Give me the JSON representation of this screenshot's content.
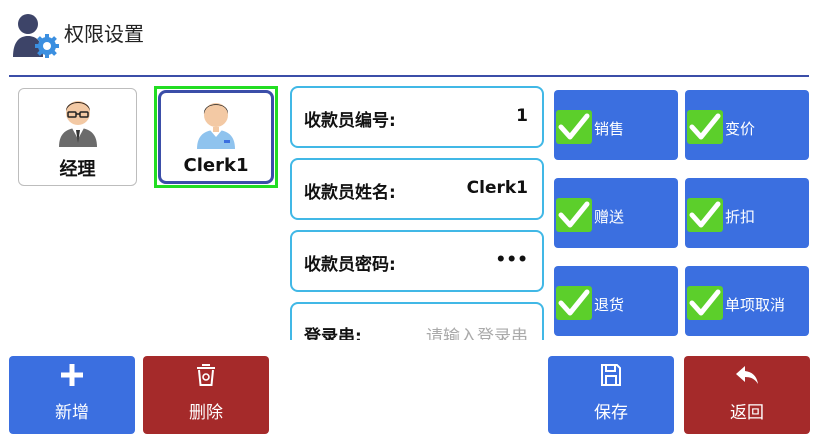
{
  "header": {
    "title": "权限设置",
    "icon": "user-settings-icon"
  },
  "users": [
    {
      "name": "经理",
      "avatar": "manager-avatar-icon",
      "selected": false
    },
    {
      "name": "Clerk1",
      "avatar": "clerk-avatar-icon",
      "selected": true
    }
  ],
  "fields": [
    {
      "label": "收款员编号:",
      "value": "1"
    },
    {
      "label": "收款员姓名:",
      "value": "Clerk1"
    },
    {
      "label": "收款员密码:",
      "value": "•••"
    },
    {
      "label": "登录串:",
      "placeholder": "请输入登录串"
    }
  ],
  "permissions": [
    {
      "label": "销售",
      "checked": true
    },
    {
      "label": "变价",
      "checked": true
    },
    {
      "label": "赠送",
      "checked": true
    },
    {
      "label": "折扣",
      "checked": true
    },
    {
      "label": "退货",
      "checked": true
    },
    {
      "label": "单项取消",
      "checked": true
    }
  ],
  "buttons": {
    "add": "新增",
    "delete": "删除",
    "save": "保存",
    "back": "返回"
  },
  "colors": {
    "accent_blue": "#3b6fe0",
    "danger_red": "#a52a2a",
    "check_green": "#5ccf2b",
    "field_border": "#41b8e6",
    "header_line": "#3b4ea8"
  }
}
